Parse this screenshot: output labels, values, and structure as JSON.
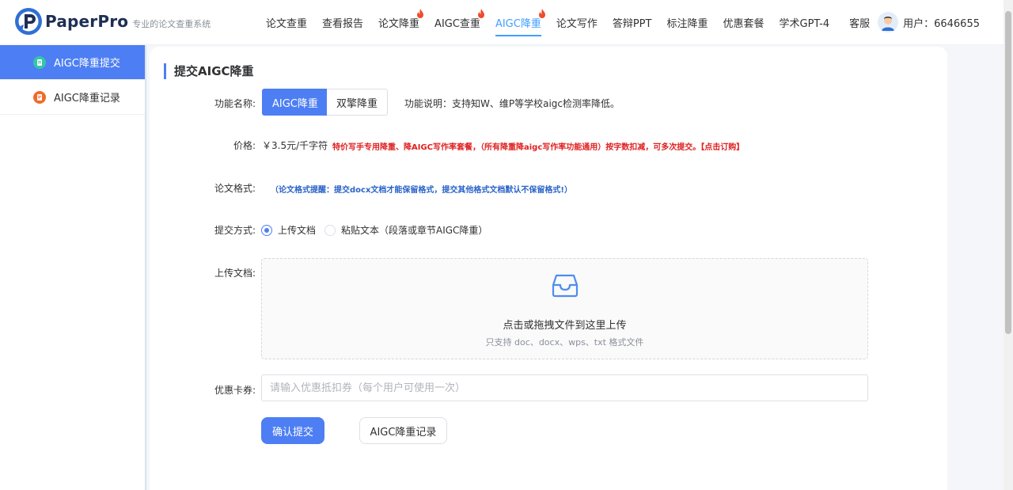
{
  "brand": {
    "name": "PaperPro",
    "subtitle": "专业的论文查重系统"
  },
  "nav": [
    {
      "label": "论文查重",
      "hot": false,
      "active": false
    },
    {
      "label": "查看报告",
      "hot": false,
      "active": false
    },
    {
      "label": "论文降重",
      "hot": true,
      "active": false
    },
    {
      "label": "AIGC查重",
      "hot": true,
      "active": false
    },
    {
      "label": "AIGC降重",
      "hot": true,
      "active": true
    },
    {
      "label": "论文写作",
      "hot": false,
      "active": false
    },
    {
      "label": "答辩PPT",
      "hot": false,
      "active": false
    },
    {
      "label": "标注降重",
      "hot": false,
      "active": false
    },
    {
      "label": "优惠套餐",
      "hot": false,
      "active": false
    },
    {
      "label": "学术GPT-4",
      "hot": false,
      "active": false
    }
  ],
  "header": {
    "service": "客服",
    "user": "用户：6646655"
  },
  "sidebar": {
    "items": [
      {
        "label": "AIGC降重提交",
        "icon": "document-icon",
        "active": true
      },
      {
        "label": "AIGC降重记录",
        "icon": "record-icon",
        "active": false
      }
    ]
  },
  "form": {
    "title": "提交AIGC降重",
    "function_label": "功能名称:",
    "function_options": [
      "AIGC降重",
      "双擎降重"
    ],
    "function_desc": "功能说明：支持知W、维P等学校aigc检测率降低。",
    "price_label": "价格:",
    "price_value": "￥3.5元/千字符",
    "price_note": "特价写手专用降重、降AIGC写作率套餐，（所有降重降aigc写作率功能通用）按字数扣减，可多次提交。【点击订购】",
    "format_label": "论文格式:",
    "format_note": "（论文格式提醒：提交docx文档才能保留格式，提交其他格式文档默认不保留格式!）",
    "method_label": "提交方式:",
    "method_options": [
      "上传文档",
      "粘贴文本（段落或章节AIGC降重）"
    ],
    "upload_label": "上传文档:",
    "upload_main": "点击或拖拽文件到这里上传",
    "upload_sub": "只支持 doc、docx、wps、txt 格式文件",
    "coupon_label": "优惠卡券:",
    "coupon_placeholder": "请输入优惠抵扣券（每个用户可使用一次）",
    "submit_label": "确认提交",
    "record_label": "AIGC降重记录"
  },
  "colors": {
    "primary": "#4d7ef3",
    "nav_active": "#409eff",
    "warning": "#e02020",
    "note_blue": "#2a63c8"
  }
}
